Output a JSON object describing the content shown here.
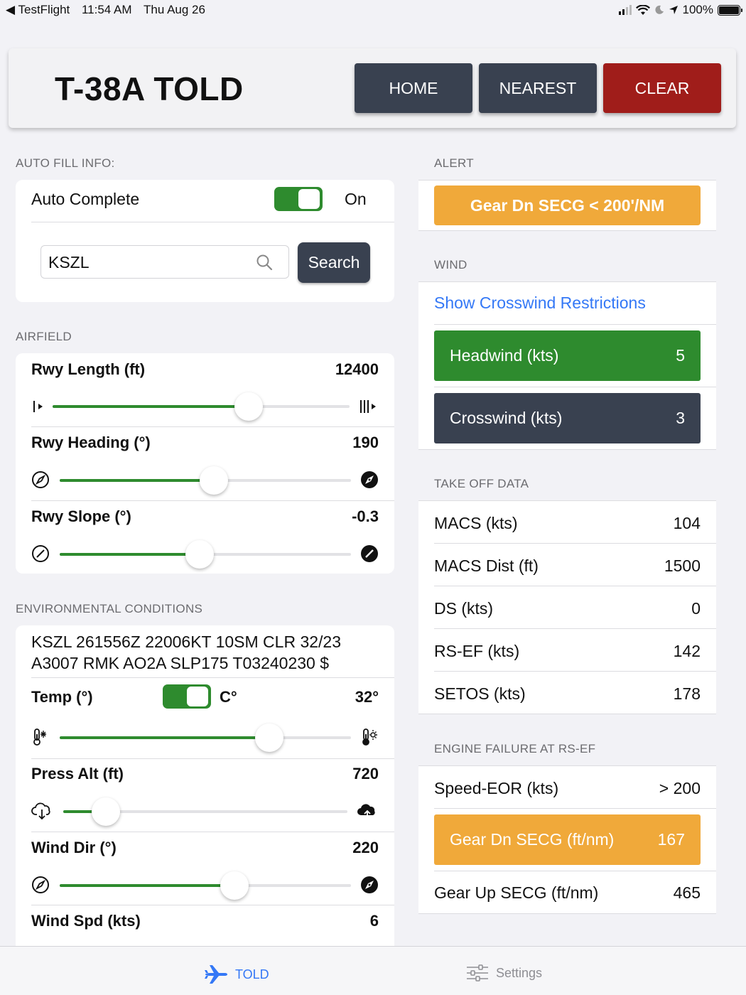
{
  "status": {
    "back_app": "TestFlight",
    "time": "11:54 AM",
    "date": "Thu Aug 26",
    "battery": "100%"
  },
  "header": {
    "title": "T-38A TOLD",
    "home": "HOME",
    "nearest": "NEAREST",
    "clear": "CLEAR"
  },
  "autofill": {
    "section": "AUTO FILL INFO:",
    "auto_complete_label": "Auto Complete",
    "auto_complete_state": "On",
    "auto_complete_on": true,
    "search_value": "KSZL",
    "search_button": "Search"
  },
  "airfield": {
    "section": "AIRFIELD",
    "rwy_length": {
      "label": "Rwy Length (ft)",
      "value": "12400",
      "fraction": 0.66
    },
    "rwy_heading": {
      "label": "Rwy Heading (°)",
      "value": "190",
      "fraction": 0.53
    },
    "rwy_slope": {
      "label": "Rwy Slope (°)",
      "value": "-0.3",
      "fraction": 0.48
    }
  },
  "environment": {
    "section": "ENVIRONMENTAL CONDITIONS",
    "metar_line1": "KSZL 261556Z 22006KT 10SM CLR 32/23",
    "metar_line2": "A3007 RMK AO2A SLP175 T03240230 $",
    "temp": {
      "label": "Temp (°)",
      "unit": "C°",
      "celsius_on": true,
      "value": "32°",
      "fraction": 0.72
    },
    "press_alt": {
      "label": "Press Alt (ft)",
      "value": "720",
      "fraction": 0.15
    },
    "wind_dir": {
      "label": "Wind Dir (°)",
      "value": "220",
      "fraction": 0.6
    },
    "wind_spd": {
      "label": "Wind Spd (kts)",
      "value": "6"
    }
  },
  "alert": {
    "section": "ALERT",
    "message": "Gear Dn SECG < 200'/NM",
    "color": "#f0a93a"
  },
  "wind": {
    "section": "WIND",
    "link": "Show Crosswind Restrictions",
    "headwind": {
      "label": "Headwind (kts)",
      "value": "5",
      "color": "#2e8b2e"
    },
    "crosswind": {
      "label": "Crosswind (kts)",
      "value": "3",
      "color": "#394150"
    }
  },
  "takeoff": {
    "section": "TAKE OFF DATA",
    "rows": [
      {
        "label": "MACS (kts)",
        "value": "104"
      },
      {
        "label": "MACS Dist (ft)",
        "value": "1500"
      },
      {
        "label": "DS (kts)",
        "value": "0"
      },
      {
        "label": "RS-EF (kts)",
        "value": "142"
      },
      {
        "label": "SETOS (kts)",
        "value": "178"
      }
    ]
  },
  "engine_failure": {
    "section": "ENGINE FAILURE AT RS-EF",
    "speed_eor": {
      "label": "Speed-EOR (kts)",
      "value": "> 200"
    },
    "gear_dn": {
      "label": "Gear Dn SECG (ft/nm)",
      "value": "167"
    },
    "gear_up": {
      "label": "Gear Up SECG (ft/nm)",
      "value": "465"
    }
  },
  "tabs": {
    "told": "TOLD",
    "settings": "Settings",
    "accent": "#3478f6"
  }
}
